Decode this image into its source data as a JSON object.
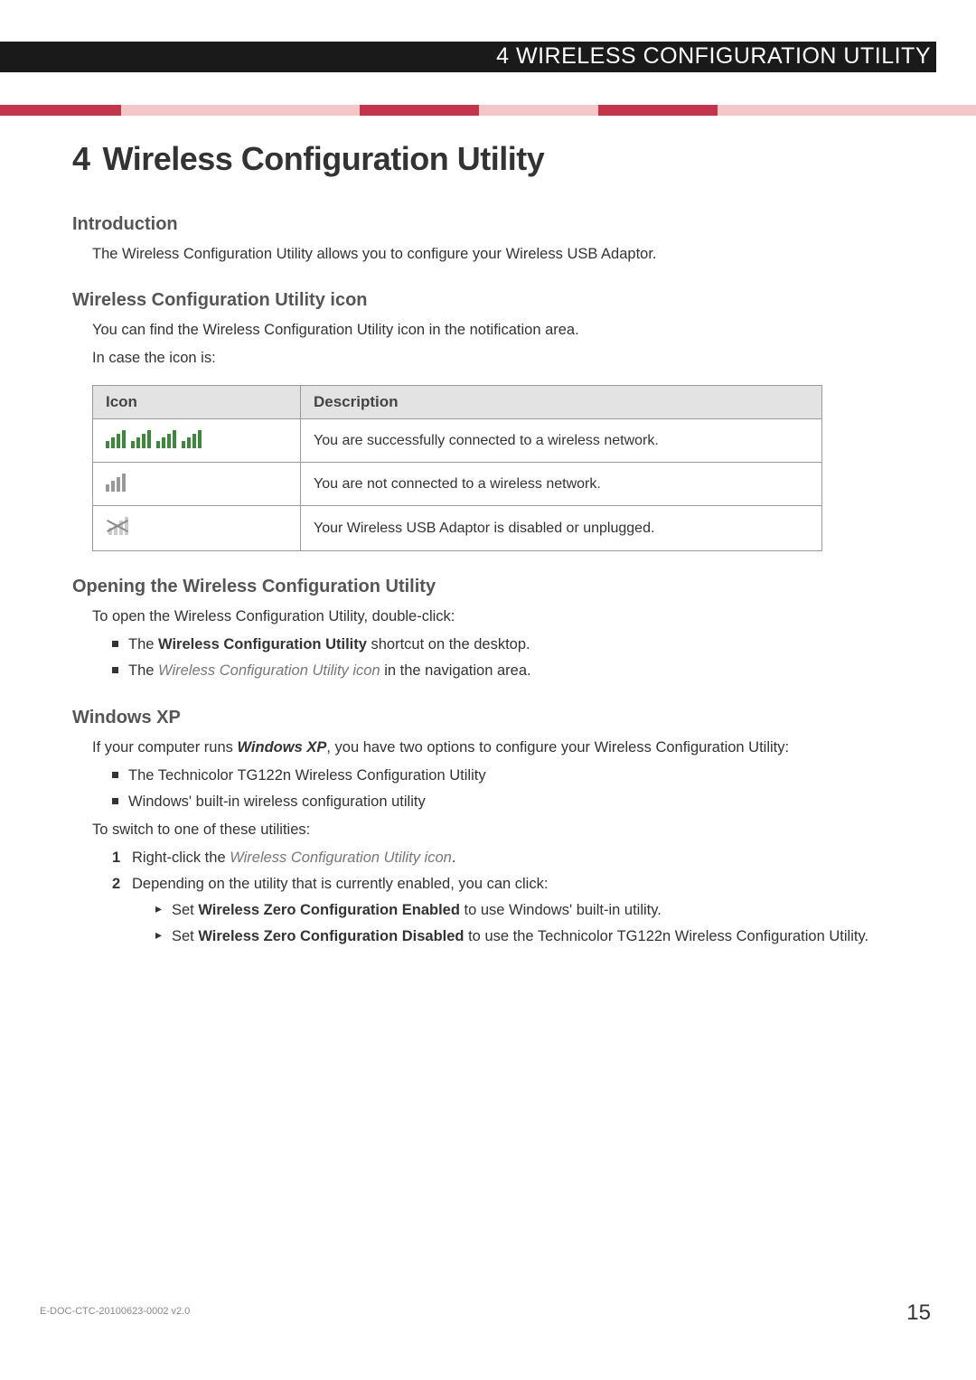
{
  "header": {
    "running_title": "4 WIRELESS CONFIGURATION UTILITY"
  },
  "chapter": {
    "number": "4",
    "title": "Wireless Configuration Utility"
  },
  "sections": {
    "intro": {
      "heading": "Introduction",
      "body": "The Wireless Configuration Utility allows you to configure your Wireless USB Adaptor."
    },
    "icon": {
      "heading": "Wireless Configuration Utility icon",
      "body1": "You can find the Wireless Configuration Utility icon in the notification area.",
      "body2": "In case the icon is:",
      "table": {
        "col_icon": "Icon",
        "col_desc": "Description",
        "rows": [
          {
            "desc": "You are successfully connected to a wireless network."
          },
          {
            "desc": "You are not connected to a wireless network."
          },
          {
            "desc": "Your Wireless USB Adaptor is disabled or unplugged."
          }
        ]
      }
    },
    "opening": {
      "heading": "Opening the Wireless Configuration Utility",
      "body": "To open the Wireless Configuration Utility, double-click:",
      "items": {
        "a_pre": "The ",
        "a_bold": "Wireless Configuration Utility",
        "a_post": " shortcut on the desktop.",
        "b_pre": "The ",
        "b_italic": "Wireless Configuration Utility icon",
        "b_post": " in the navigation area."
      }
    },
    "winxp": {
      "heading": "Windows XP",
      "body_pre": "If your computer runs ",
      "body_bold": "Windows XP",
      "body_post": ", you have two options to configure your Wireless Configuration Utility:",
      "opts": {
        "a": "The Technicolor TG122n Wireless Configuration Utility",
        "b": "Windows' built-in wireless configuration utility"
      },
      "switch_body": "To switch to one of these utilities:",
      "steps": {
        "s1_pre": "Right-click the ",
        "s1_italic": "Wireless Configuration Utility icon",
        "s1_post": ".",
        "s2": "Depending on the utility that is currently enabled, you can click:",
        "sub": {
          "a_pre": "Set ",
          "a_bold": "Wireless Zero Configuration Enabled",
          "a_post": " to use Windows' built-in utility.",
          "b_pre": "Set ",
          "b_bold": "Wireless Zero Configuration Disabled",
          "b_post": " to use the Technicolor TG122n Wireless Configuration Utility."
        }
      }
    }
  },
  "footer": {
    "doc_id": "E-DOC-CTC-20100623-0002 v2.0",
    "page": "15"
  }
}
